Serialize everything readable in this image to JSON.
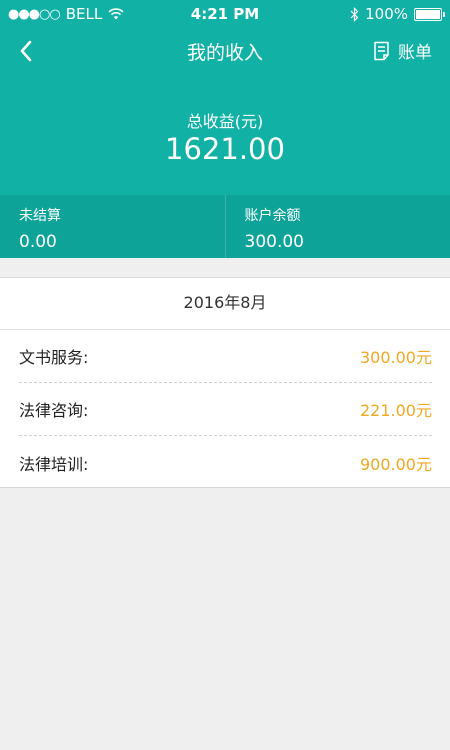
{
  "status": {
    "signal": "●●●○○",
    "carrier": "BELL",
    "time": "4:21 PM",
    "bluetooth": "bluetooth-icon",
    "battery_pct": "100%"
  },
  "nav": {
    "title": "我的收入",
    "bill_label": "账单"
  },
  "summary": {
    "total_label": "总收益(元)",
    "total_value": "1621.00",
    "unsettled_label": "未结算",
    "unsettled_value": "0.00",
    "balance_label": "账户余额",
    "balance_value": "300.00"
  },
  "income": {
    "month": "2016年8月",
    "rows": [
      {
        "name": "文书服务:",
        "amount": "300.00元"
      },
      {
        "name": "法律咨询:",
        "amount": "221.00元"
      },
      {
        "name": "法律培训:",
        "amount": "900.00元"
      }
    ]
  },
  "colors": {
    "primary": "#12b1a6",
    "primary_dark": "#0ea399",
    "amount": "#f0a823",
    "background": "#efefef"
  }
}
